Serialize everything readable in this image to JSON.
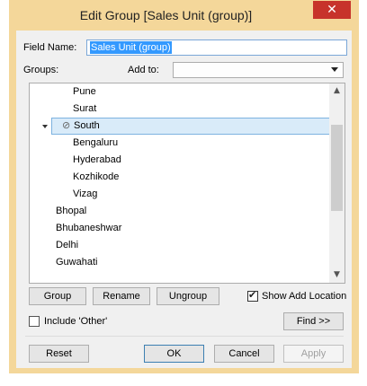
{
  "window": {
    "title": "Edit Group [Sales Unit (group)]",
    "close_glyph": "✕"
  },
  "field_name": {
    "label": "Field Name:",
    "value": "Sales Unit (group)"
  },
  "groups_label": "Groups:",
  "add_to": {
    "label": "Add to:",
    "value": ""
  },
  "tree": {
    "items": [
      {
        "label": "Pune"
      },
      {
        "label": "Surat"
      },
      {
        "label": "South"
      },
      {
        "label": "Bengaluru"
      },
      {
        "label": "Hyderabad"
      },
      {
        "label": "Kozhikode"
      },
      {
        "label": "Vizag"
      },
      {
        "label": "Bhopal"
      },
      {
        "label": "Bhubaneshwar"
      },
      {
        "label": "Delhi"
      },
      {
        "label": "Guwahati"
      }
    ]
  },
  "buttons": {
    "group": "Group",
    "rename": "Rename",
    "ungroup": "Ungroup",
    "find": "Find >>",
    "reset": "Reset",
    "ok": "OK",
    "cancel": "Cancel",
    "apply": "Apply"
  },
  "show_add_location": {
    "label": "Show Add Location",
    "checked": true
  },
  "include_other": {
    "label": "Include 'Other'",
    "checked": false
  },
  "colors": {
    "title_bar": "#f4d79a",
    "close_button": "#c7332b",
    "selection": "#d9ebf9",
    "text_highlight": "#3399ff"
  },
  "icons": {
    "expander": "triangle-down-icon",
    "group": "paperclip-icon",
    "scroll_up": "chevron-up-icon",
    "scroll_down": "chevron-down-icon",
    "check": "checkmark-icon"
  }
}
